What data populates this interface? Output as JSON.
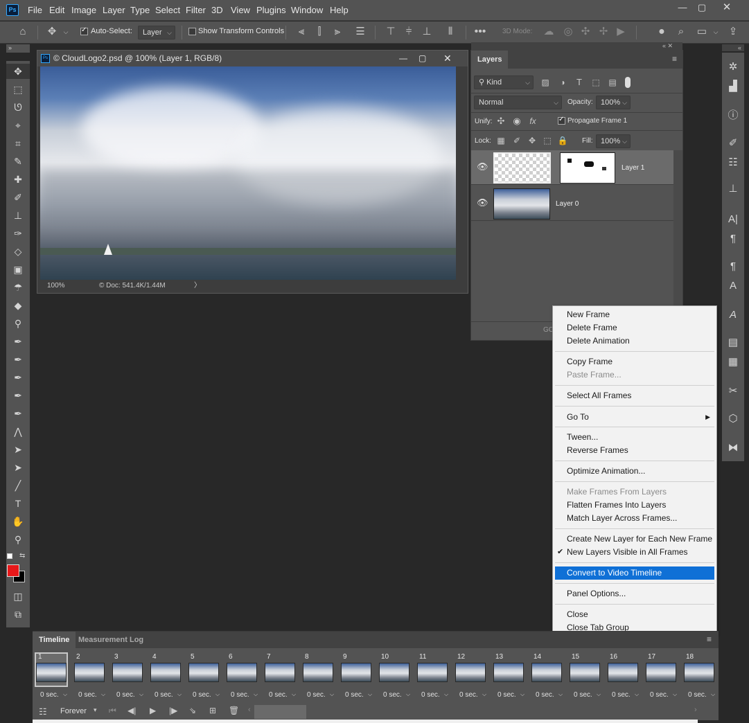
{
  "menubar": {
    "logo": "Ps",
    "items": [
      "File",
      "Edit",
      "Image",
      "Layer",
      "Type",
      "Select",
      "Filter",
      "3D",
      "View",
      "Plugins",
      "Window",
      "Help"
    ]
  },
  "options": {
    "auto_select_label": "Auto-Select:",
    "auto_select_value": "Layer",
    "show_transform_label": "Show Transform Controls",
    "mode3d_label": "3D Mode:"
  },
  "document": {
    "title": "© CloudLogo2.psd @ 100% (Layer 1, RGB/8)",
    "zoom": "100%",
    "doc_info": "© Doc: 541.4K/1.44M"
  },
  "layers_panel": {
    "tab": "Layers",
    "filter_kind": "Kind",
    "blend_mode": "Normal",
    "opacity_label": "Opacity:",
    "opacity_value": "100%",
    "unify_label": "Unify:",
    "propagate_label": "Propagate Frame 1",
    "lock_label": "Lock:",
    "fill_label": "Fill:",
    "fill_value": "100%",
    "layers": [
      {
        "name": "Layer 1",
        "selected": true
      },
      {
        "name": "Layer 0",
        "selected": false
      }
    ]
  },
  "context_menu": {
    "items": [
      {
        "label": "New Frame",
        "disabled": false
      },
      {
        "label": "Delete Frame",
        "disabled": false
      },
      {
        "label": "Delete Animation",
        "disabled": false
      },
      {
        "label": "Copy Frame",
        "disabled": false
      },
      {
        "label": "Paste Frame...",
        "disabled": true
      },
      {
        "label": "Select All Frames",
        "disabled": false
      },
      {
        "label": "Go To",
        "disabled": false,
        "submenu": true
      },
      {
        "label": "Tween...",
        "disabled": false
      },
      {
        "label": "Reverse Frames",
        "disabled": false
      },
      {
        "label": "Optimize Animation...",
        "disabled": false
      },
      {
        "label": "Make Frames From Layers",
        "disabled": true
      },
      {
        "label": "Flatten Frames Into Layers",
        "disabled": false
      },
      {
        "label": "Match Layer Across Frames...",
        "disabled": false
      },
      {
        "label": "Create New Layer for Each New Frame",
        "disabled": false
      },
      {
        "label": "New Layers Visible in All Frames",
        "disabled": false,
        "checked": true
      },
      {
        "label": "Convert to Video Timeline",
        "disabled": false,
        "highlighted": true
      },
      {
        "label": "Panel Options...",
        "disabled": false
      },
      {
        "label": "Close",
        "disabled": false
      },
      {
        "label": "Close Tab Group",
        "disabled": false
      }
    ]
  },
  "timeline": {
    "tabs": [
      "Timeline",
      "Measurement Log"
    ],
    "frames": [
      {
        "num": "1",
        "dur": "0 sec."
      },
      {
        "num": "2",
        "dur": "0 sec."
      },
      {
        "num": "3",
        "dur": "0 sec."
      },
      {
        "num": "4",
        "dur": "0 sec."
      },
      {
        "num": "5",
        "dur": "0 sec."
      },
      {
        "num": "6",
        "dur": "0 sec."
      },
      {
        "num": "7",
        "dur": "0 sec."
      },
      {
        "num": "8",
        "dur": "0 sec."
      },
      {
        "num": "9",
        "dur": "0 sec."
      },
      {
        "num": "10",
        "dur": "0 sec."
      },
      {
        "num": "11",
        "dur": "0 sec."
      },
      {
        "num": "12",
        "dur": "0 sec."
      },
      {
        "num": "13",
        "dur": "0 sec."
      },
      {
        "num": "14",
        "dur": "0 sec."
      },
      {
        "num": "15",
        "dur": "0 sec."
      },
      {
        "num": "16",
        "dur": "0 sec."
      },
      {
        "num": "17",
        "dur": "0 sec."
      },
      {
        "num": "18",
        "dur": "0 sec."
      }
    ],
    "loop": "Forever"
  },
  "colors": {
    "foreground": "#e8181a",
    "background": "#000000",
    "highlight": "#0f70d6"
  }
}
